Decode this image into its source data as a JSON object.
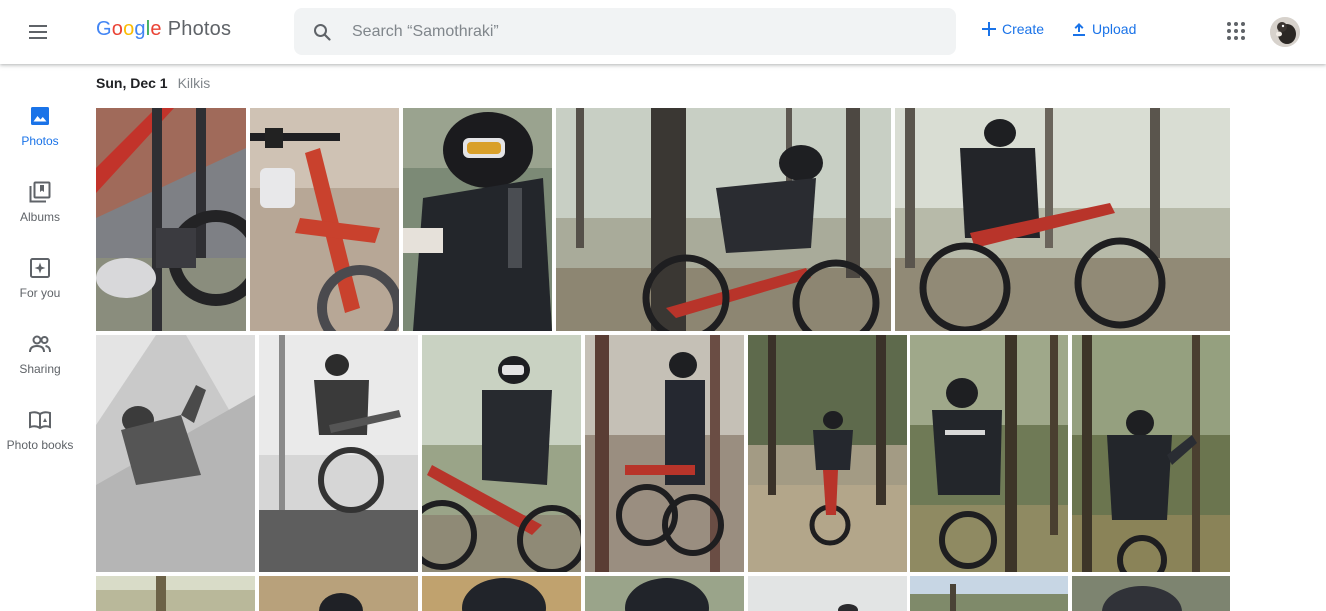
{
  "header": {
    "brand_letters": [
      "G",
      "o",
      "o",
      "g",
      "l",
      "e"
    ],
    "brand_word": "Photos",
    "search_placeholder": "Search “Samothraki”",
    "create_label": "Create",
    "upload_label": "Upload",
    "icons": {
      "menu": "menu-icon",
      "search": "search-icon",
      "create": "plus-icon",
      "upload": "upload-icon",
      "apps": "apps-grid-icon"
    }
  },
  "sidebar": {
    "items": [
      {
        "label": "Photos",
        "icon": "photo-icon",
        "active": true
      },
      {
        "label": "Albums",
        "icon": "albums-icon",
        "active": false
      },
      {
        "label": "For you",
        "icon": "for-you-icon",
        "active": false
      },
      {
        "label": "Sharing",
        "icon": "sharing-icon",
        "active": false
      },
      {
        "label": "Photo books",
        "icon": "photo-book-icon",
        "active": false
      }
    ]
  },
  "section": {
    "date": "Sun, Dec 1",
    "location": "Kilkis"
  },
  "colors": {
    "accent": "#1a73e8",
    "search_bg": "#f1f3f4",
    "muted_text": "#5f6368"
  }
}
